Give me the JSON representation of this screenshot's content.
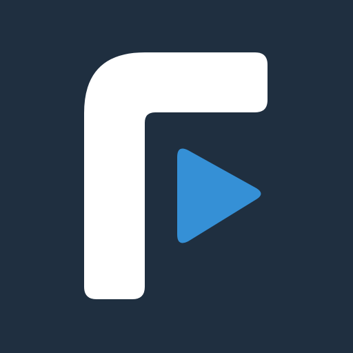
{
  "icon": {
    "name": "app-logo",
    "parts": {
      "letterform": "f-letterform",
      "play": "play-triangle-icon"
    }
  },
  "colors": {
    "background": "#1f2f40",
    "letterform": "#ffffff",
    "play": "#3590d6"
  }
}
